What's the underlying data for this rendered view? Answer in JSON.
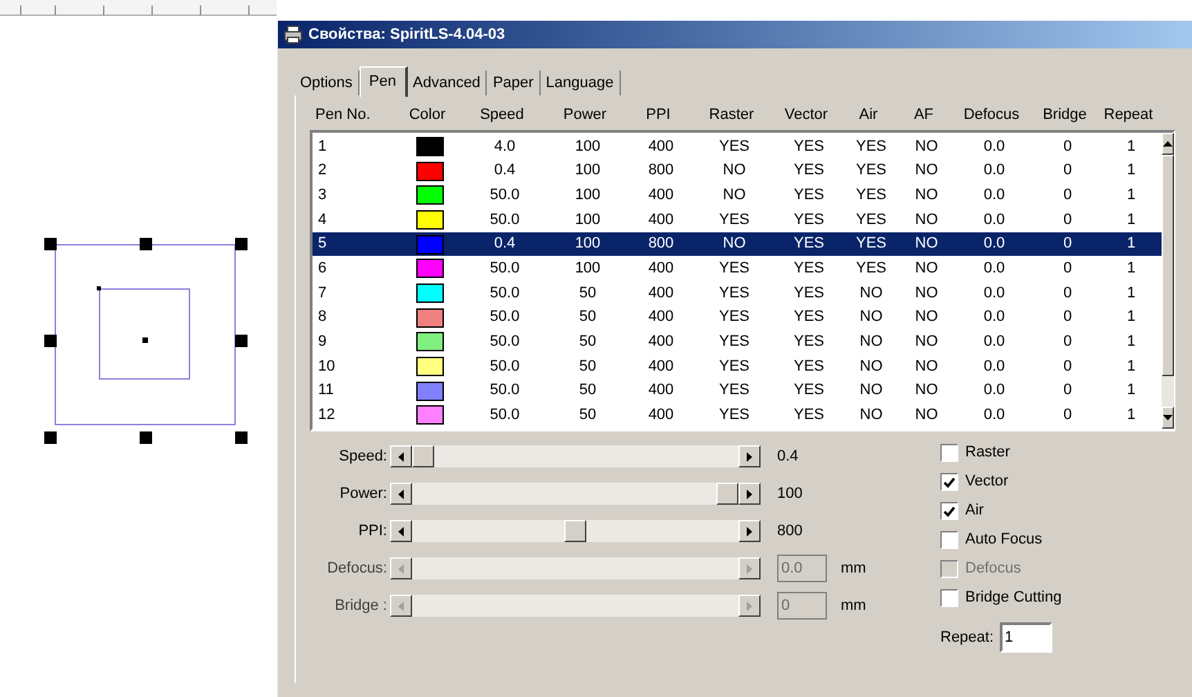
{
  "window": {
    "title": "Свойства: SpiritLS-4.04-03"
  },
  "tabs": [
    {
      "label": "Options",
      "selected": false
    },
    {
      "label": "Pen",
      "selected": true
    },
    {
      "label": "Advanced",
      "selected": false
    },
    {
      "label": "Paper",
      "selected": false
    },
    {
      "label": "Language",
      "selected": false
    }
  ],
  "table": {
    "columns": [
      "Pen No.",
      "Color",
      "Speed",
      "Power",
      "PPI",
      "Raster",
      "Vector",
      "Air",
      "AF",
      "Defocus",
      "Bridge",
      "Repeat"
    ],
    "rows": [
      {
        "selected": false,
        "cells": [
          {
            "text": "1"
          },
          {
            "color": "#000000"
          },
          {
            "text": "4.0"
          },
          {
            "text": "100"
          },
          {
            "text": "400"
          },
          {
            "text": "YES"
          },
          {
            "text": "YES"
          },
          {
            "text": "YES"
          },
          {
            "text": "NO"
          },
          {
            "text": "0.0"
          },
          {
            "text": "0"
          },
          {
            "text": "1"
          }
        ]
      },
      {
        "selected": false,
        "cells": [
          {
            "text": "2"
          },
          {
            "color": "#ff0000"
          },
          {
            "text": "0.4"
          },
          {
            "text": "100"
          },
          {
            "text": "800"
          },
          {
            "text": "NO"
          },
          {
            "text": "YES"
          },
          {
            "text": "YES"
          },
          {
            "text": "NO"
          },
          {
            "text": "0.0"
          },
          {
            "text": "0"
          },
          {
            "text": "1"
          }
        ]
      },
      {
        "selected": false,
        "cells": [
          {
            "text": "3"
          },
          {
            "color": "#00ff00"
          },
          {
            "text": "50.0"
          },
          {
            "text": "100"
          },
          {
            "text": "400"
          },
          {
            "text": "NO"
          },
          {
            "text": "YES"
          },
          {
            "text": "YES"
          },
          {
            "text": "NO"
          },
          {
            "text": "0.0"
          },
          {
            "text": "0"
          },
          {
            "text": "1"
          }
        ]
      },
      {
        "selected": false,
        "cells": [
          {
            "text": "4"
          },
          {
            "color": "#ffff00"
          },
          {
            "text": "50.0"
          },
          {
            "text": "100"
          },
          {
            "text": "400"
          },
          {
            "text": "YES"
          },
          {
            "text": "YES"
          },
          {
            "text": "YES"
          },
          {
            "text": "NO"
          },
          {
            "text": "0.0"
          },
          {
            "text": "0"
          },
          {
            "text": "1"
          }
        ]
      },
      {
        "selected": true,
        "cells": [
          {
            "text": "5"
          },
          {
            "color": "#0000ff"
          },
          {
            "text": "0.4"
          },
          {
            "text": "100"
          },
          {
            "text": "800"
          },
          {
            "text": "NO"
          },
          {
            "text": "YES"
          },
          {
            "text": "YES"
          },
          {
            "text": "NO"
          },
          {
            "text": "0.0"
          },
          {
            "text": "0"
          },
          {
            "text": "1"
          }
        ]
      },
      {
        "selected": false,
        "cells": [
          {
            "text": "6"
          },
          {
            "color": "#ff00ff"
          },
          {
            "text": "50.0"
          },
          {
            "text": "100"
          },
          {
            "text": "400"
          },
          {
            "text": "YES"
          },
          {
            "text": "YES"
          },
          {
            "text": "YES"
          },
          {
            "text": "NO"
          },
          {
            "text": "0.0"
          },
          {
            "text": "0"
          },
          {
            "text": "1"
          }
        ]
      },
      {
        "selected": false,
        "cells": [
          {
            "text": "7"
          },
          {
            "color": "#00ffff"
          },
          {
            "text": "50.0"
          },
          {
            "text": "50"
          },
          {
            "text": "400"
          },
          {
            "text": "YES"
          },
          {
            "text": "YES"
          },
          {
            "text": "NO"
          },
          {
            "text": "NO"
          },
          {
            "text": "0.0"
          },
          {
            "text": "0"
          },
          {
            "text": "1"
          }
        ]
      },
      {
        "selected": false,
        "cells": [
          {
            "text": "8"
          },
          {
            "color": "#f08080"
          },
          {
            "text": "50.0"
          },
          {
            "text": "50"
          },
          {
            "text": "400"
          },
          {
            "text": "YES"
          },
          {
            "text": "YES"
          },
          {
            "text": "NO"
          },
          {
            "text": "NO"
          },
          {
            "text": "0.0"
          },
          {
            "text": "0"
          },
          {
            "text": "1"
          }
        ]
      },
      {
        "selected": false,
        "cells": [
          {
            "text": "9"
          },
          {
            "color": "#80f080"
          },
          {
            "text": "50.0"
          },
          {
            "text": "50"
          },
          {
            "text": "400"
          },
          {
            "text": "YES"
          },
          {
            "text": "YES"
          },
          {
            "text": "NO"
          },
          {
            "text": "NO"
          },
          {
            "text": "0.0"
          },
          {
            "text": "0"
          },
          {
            "text": "1"
          }
        ]
      },
      {
        "selected": false,
        "cells": [
          {
            "text": "10"
          },
          {
            "color": "#ffff80"
          },
          {
            "text": "50.0"
          },
          {
            "text": "50"
          },
          {
            "text": "400"
          },
          {
            "text": "YES"
          },
          {
            "text": "YES"
          },
          {
            "text": "NO"
          },
          {
            "text": "NO"
          },
          {
            "text": "0.0"
          },
          {
            "text": "0"
          },
          {
            "text": "1"
          }
        ]
      },
      {
        "selected": false,
        "cells": [
          {
            "text": "11"
          },
          {
            "color": "#8080ff"
          },
          {
            "text": "50.0"
          },
          {
            "text": "50"
          },
          {
            "text": "400"
          },
          {
            "text": "YES"
          },
          {
            "text": "YES"
          },
          {
            "text": "NO"
          },
          {
            "text": "NO"
          },
          {
            "text": "0.0"
          },
          {
            "text": "0"
          },
          {
            "text": "1"
          }
        ]
      },
      {
        "selected": false,
        "cells": [
          {
            "text": "12"
          },
          {
            "color": "#ff80ff"
          },
          {
            "text": "50.0"
          },
          {
            "text": "50"
          },
          {
            "text": "400"
          },
          {
            "text": "YES"
          },
          {
            "text": "YES"
          },
          {
            "text": "NO"
          },
          {
            "text": "NO"
          },
          {
            "text": "0.0"
          },
          {
            "text": "0"
          },
          {
            "text": "1"
          }
        ]
      }
    ]
  },
  "sliders": [
    {
      "label": "Speed:",
      "level": 0.0,
      "value": "0.4",
      "disabled": false
    },
    {
      "label": "Power:",
      "level": 1.0,
      "value": "100",
      "disabled": false
    },
    {
      "label": "PPI:",
      "level": 0.5,
      "value": "800",
      "disabled": false
    },
    {
      "label": "Defocus:",
      "value": "0.0",
      "unit": "mm",
      "disabled": true
    },
    {
      "label": "Bridge :",
      "value": "0",
      "unit": "mm",
      "disabled": true
    }
  ],
  "checkboxes": [
    {
      "label": "Raster",
      "checked": false,
      "disabled": false
    },
    {
      "label": "Vector",
      "checked": true,
      "disabled": false
    },
    {
      "label": "Air",
      "checked": true,
      "disabled": false
    },
    {
      "label": "Auto Focus",
      "checked": false,
      "disabled": false
    },
    {
      "label": "Defocus",
      "checked": false,
      "disabled": true
    },
    {
      "label": "Bridge Cutting",
      "checked": false,
      "disabled": false
    }
  ],
  "repeat": {
    "label": "Repeat:",
    "value": "1"
  }
}
